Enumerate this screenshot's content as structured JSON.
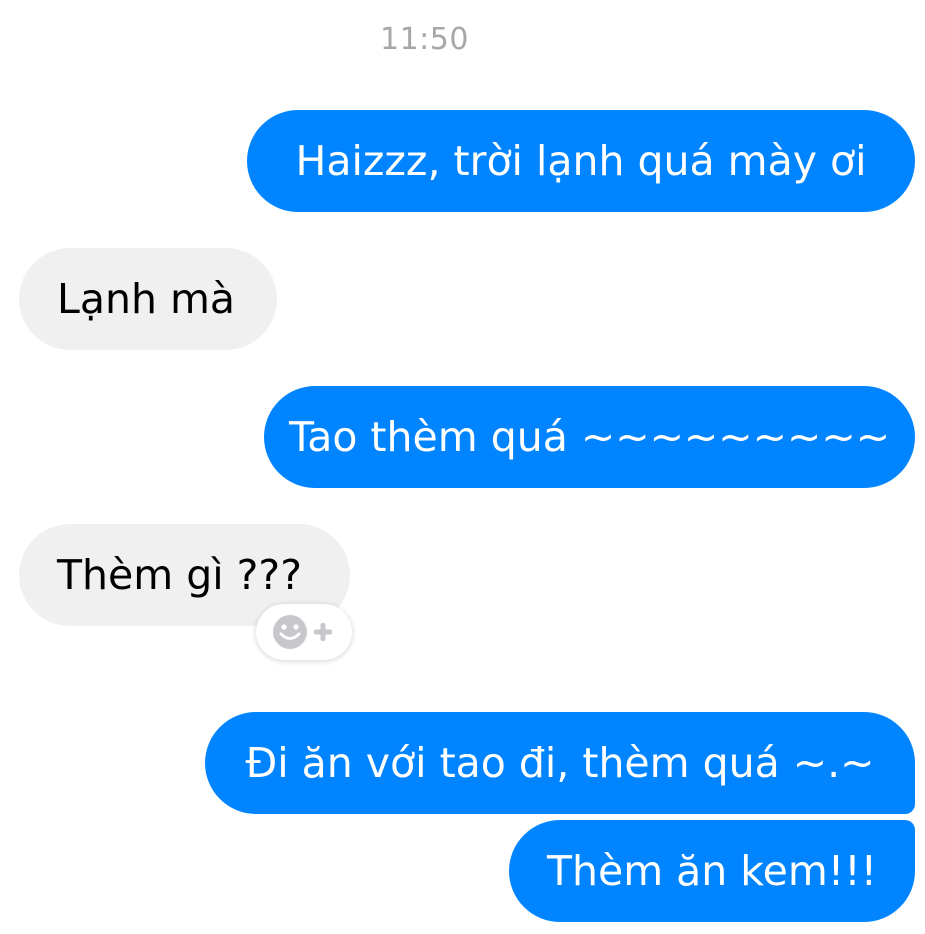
{
  "conversation": {
    "timestamp": "11:50",
    "messages": [
      {
        "sender": "me",
        "text": "Haizzz, trời lạnh quá mày ơi"
      },
      {
        "sender": "friend",
        "text": "Lạnh mà"
      },
      {
        "sender": "me",
        "text": "Tao thèm quá ~~~~~~~~~"
      },
      {
        "sender": "friend",
        "text": "Thèm gì ???"
      },
      {
        "sender": "me",
        "text": "Đi ăn với tao đi, thèm quá ~.~"
      },
      {
        "sender": "me",
        "text": "Thèm ăn kem!!!"
      }
    ]
  },
  "colors": {
    "outgoing_bubble": "#0084ff",
    "incoming_bubble": "#f1f0f0",
    "timestamp_text": "#a7a7ab",
    "react_icon": "#c8c8cc"
  },
  "icons": {
    "reaction": "smiley-plus-icon"
  }
}
